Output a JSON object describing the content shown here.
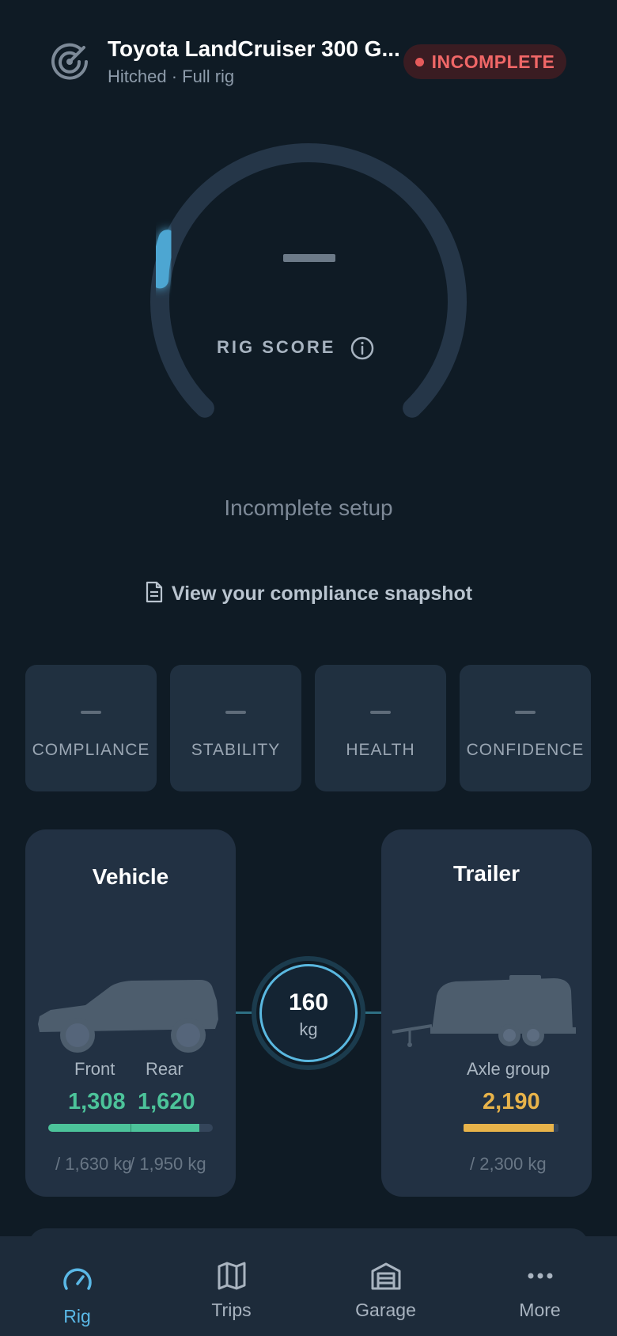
{
  "header": {
    "title": "Toyota LandCruiser 300 G...",
    "subtitle": "Hitched · Full rig",
    "status_badge": "INCOMPLETE",
    "logo_icon": "radar-icon"
  },
  "score": {
    "value": "—",
    "label": "RIG SCORE",
    "status_text": "Incomplete setup",
    "gauge_fill_fraction": 0.06,
    "info_icon": "info-icon"
  },
  "snapshot_link": {
    "label": "View your compliance snapshot",
    "icon": "document-icon"
  },
  "metrics": [
    {
      "label": "COMPLIANCE",
      "value": "—"
    },
    {
      "label": "STABILITY",
      "value": "—"
    },
    {
      "label": "HEALTH",
      "value": "—"
    },
    {
      "label": "CONFIDENCE",
      "value": "—"
    }
  ],
  "vehicle": {
    "title": "Vehicle",
    "front_label": "Front",
    "rear_label": "Rear",
    "front_value": "1,308",
    "rear_value": "1,620",
    "front_limit": "/ 1,630 kg",
    "rear_limit": "/ 1,950 kg",
    "front_fraction": 0.8,
    "rear_fraction": 0.83
  },
  "hitch": {
    "value": "160",
    "unit": "kg"
  },
  "trailer": {
    "title": "Trailer",
    "axle_label": "Axle group",
    "axle_value": "2,190",
    "axle_limit": "/ 2,300 kg",
    "axle_fraction": 0.95
  },
  "nav": [
    {
      "label": "Rig",
      "icon": "speedometer-icon",
      "active": true
    },
    {
      "label": "Trips",
      "icon": "map-icon",
      "active": false
    },
    {
      "label": "Garage",
      "icon": "garage-icon",
      "active": false
    },
    {
      "label": "More",
      "icon": "more-dots-icon",
      "active": false
    }
  ],
  "colors": {
    "background": "#0f1b25",
    "card": "#223143",
    "accent": "#5ab8e6",
    "ok_green": "#4cc39a",
    "warn_yellow": "#e8b34a",
    "danger_red": "#f06767"
  }
}
